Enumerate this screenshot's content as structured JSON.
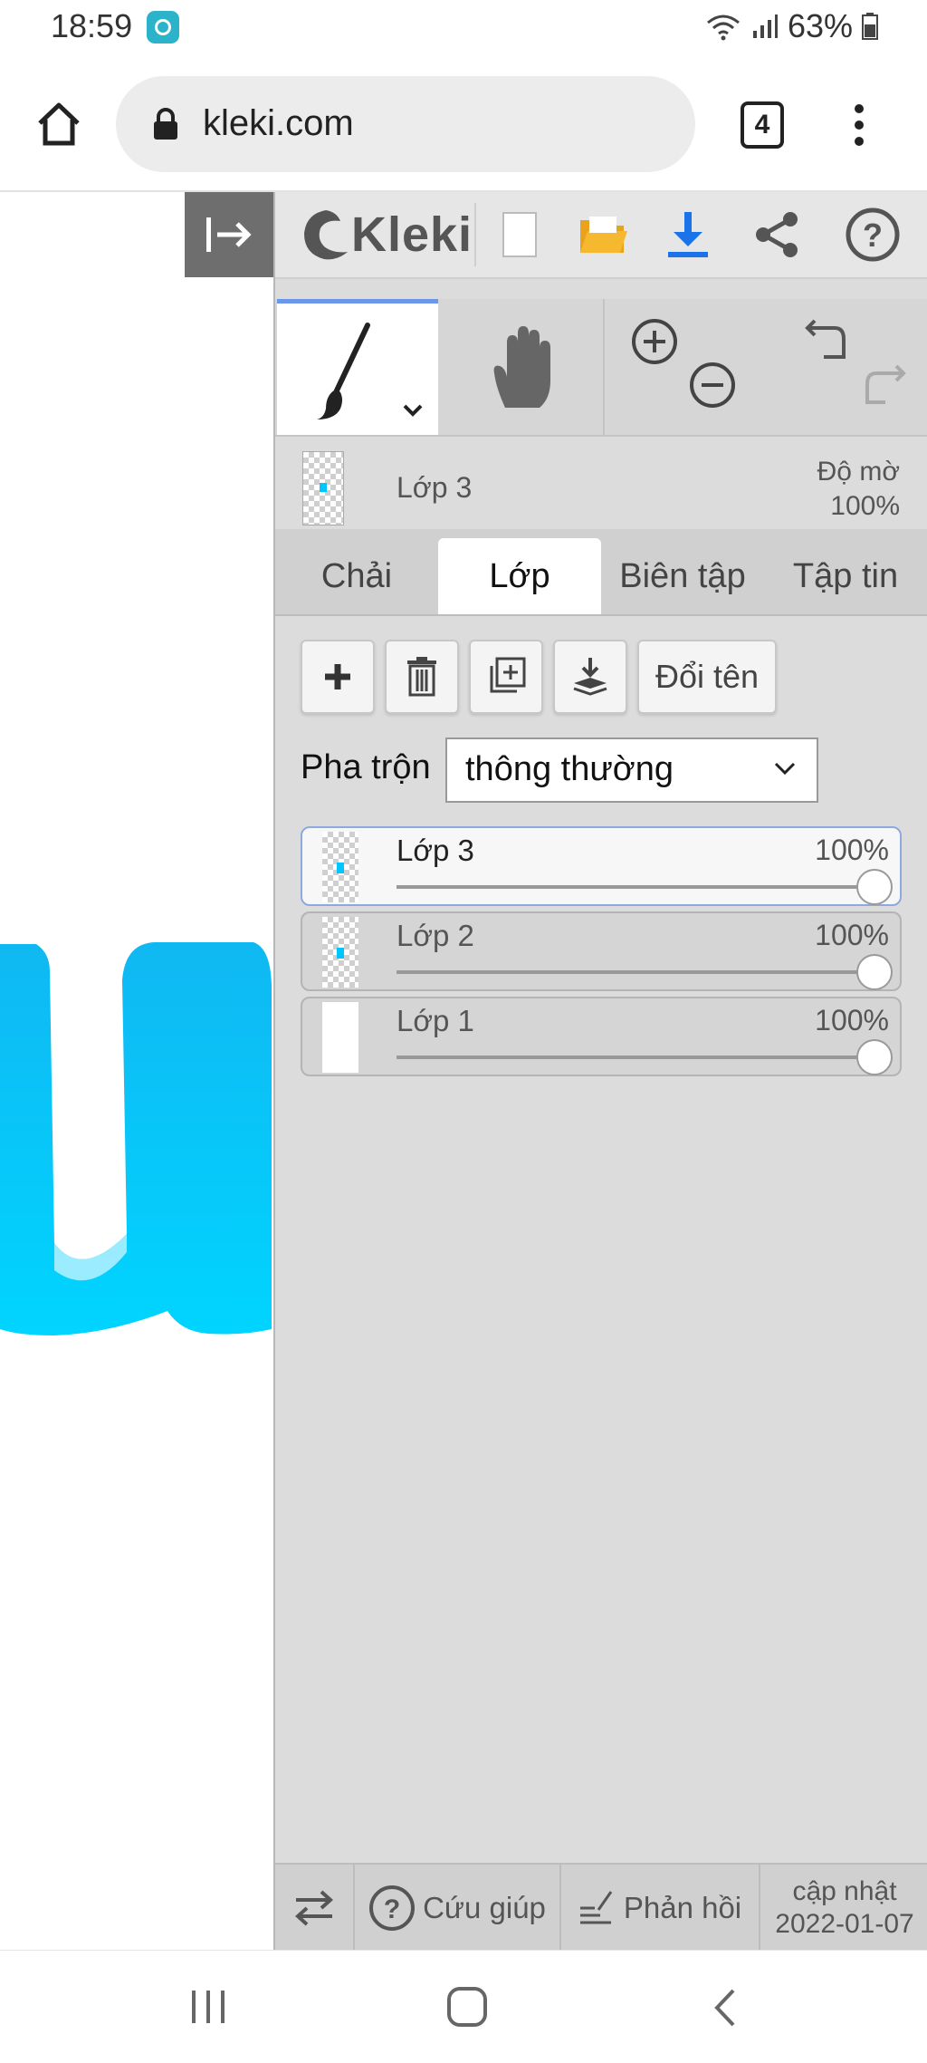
{
  "status_bar": {
    "time": "18:59",
    "battery": "63%"
  },
  "browser": {
    "url": "kleki.com",
    "tab_count": "4"
  },
  "app": {
    "logo_text": "Kleki"
  },
  "layer_preview": {
    "name": "Lớp 3",
    "opacity_label": "Độ mờ",
    "opacity_value": "100%"
  },
  "tabs": [
    {
      "label": "Chải",
      "active": false
    },
    {
      "label": "Lớp",
      "active": true
    },
    {
      "label": "Biên tập",
      "active": false
    },
    {
      "label": "Tập tin",
      "active": false
    }
  ],
  "layer_buttons": {
    "rename": "Đổi tên"
  },
  "blend": {
    "label": "Pha trộn",
    "value": "thông thường"
  },
  "layers": [
    {
      "name": "Lớp 3",
      "opacity": "100%",
      "selected": true
    },
    {
      "name": "Lớp 2",
      "opacity": "100%",
      "selected": false
    },
    {
      "name": "Lớp 1",
      "opacity": "100%",
      "selected": false
    }
  ],
  "footer": {
    "help": "Cứu giúp",
    "feedback": "Phản hồi",
    "update_label": "cập nhật",
    "update_date": "2022-01-07"
  },
  "colors": {
    "accent": "#1a73e8",
    "brush_stroke": "#00c6ff",
    "panel_bg": "#dcdcdc",
    "folder": "#f5b82e"
  },
  "icons": [
    "home-icon",
    "lock-icon",
    "tabs-icon",
    "more-icon",
    "collapse-panel-icon",
    "kleki-logo-icon",
    "new-file-icon",
    "open-folder-icon",
    "download-icon",
    "share-icon",
    "help-icon",
    "brush-icon",
    "hand-icon",
    "zoom-in-icon",
    "zoom-out-icon",
    "undo-icon",
    "redo-icon",
    "add-layer-icon",
    "delete-layer-icon",
    "duplicate-layer-icon",
    "merge-down-icon",
    "swap-icon",
    "feedback-icon",
    "recents-icon",
    "home-nav-icon",
    "back-icon"
  ]
}
